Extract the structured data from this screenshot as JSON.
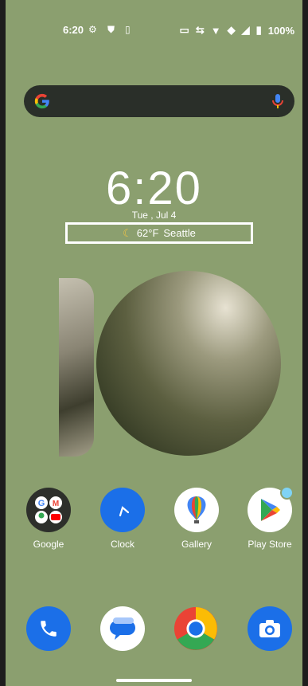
{
  "status_bar": {
    "time": "6:20",
    "battery": "100%"
  },
  "widget": {
    "time": "6:20",
    "date": "Tue , Jul 4",
    "temp": "62°F",
    "city": "Seattle"
  },
  "apps": [
    {
      "label": "Google"
    },
    {
      "label": "Clock"
    },
    {
      "label": "Gallery"
    },
    {
      "label": "Play Store"
    }
  ],
  "dock": [
    "Phone",
    "Messages",
    "Chrome",
    "Camera"
  ],
  "colors": {
    "wallpaper": "#8b9f6f",
    "search_bg": "#2a2f29",
    "clock_blue": "#1b6fe8"
  }
}
